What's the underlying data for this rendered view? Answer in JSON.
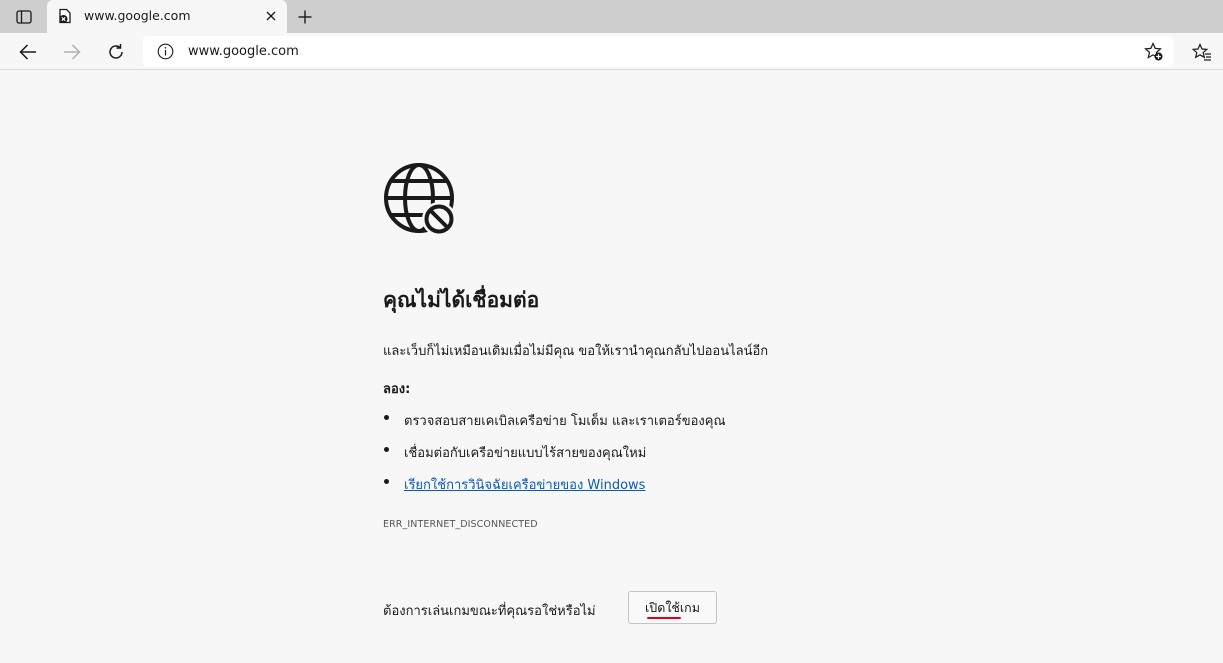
{
  "browser": {
    "tab": {
      "title": "www.google.com"
    },
    "address_bar": {
      "url": "www.google.com"
    }
  },
  "icons": {
    "tab_actions": "tab-actions-icon",
    "favicon": "offline-page-icon",
    "close": "close-icon",
    "new_tab": "plus-icon",
    "back": "back-arrow-icon",
    "forward": "forward-arrow-icon",
    "refresh": "refresh-icon",
    "info": "info-icon",
    "add_favorite": "star-add-icon",
    "favorites": "favorites-icon",
    "globe": "globe-blocked-icon"
  },
  "error_page": {
    "heading": "คุณไม่ได้เชื่อมต่อ",
    "description": "และเว็บก็ไม่เหมือนเดิมเมื่อไม่มีคุณ ขอให้เรานำคุณกลับไปออนไลน์อีก",
    "try_label": "ลอง:",
    "suggestions": [
      "ตรวจสอบสายเคเบิลเครือข่าย โมเด็ม และเราเตอร์ของคุณ",
      "เชื่อมต่อกับเครือข่ายแบบไร้สายของคุณใหม่",
      "เรียกใช้การวินิจฉัยเครือข่ายของ Windows"
    ],
    "error_code": "ERR_INTERNET_DISCONNECTED",
    "game_prompt": "ต้องการเล่นเกมขณะที่คุณรอใช่หรือไม่",
    "game_button": "เปิดใช้เกม"
  },
  "colors": {
    "link": "#0a5bb7",
    "spell_underline": "#e0001b",
    "page_background": "#f7f7f7",
    "tabstrip_background": "#cecece"
  }
}
